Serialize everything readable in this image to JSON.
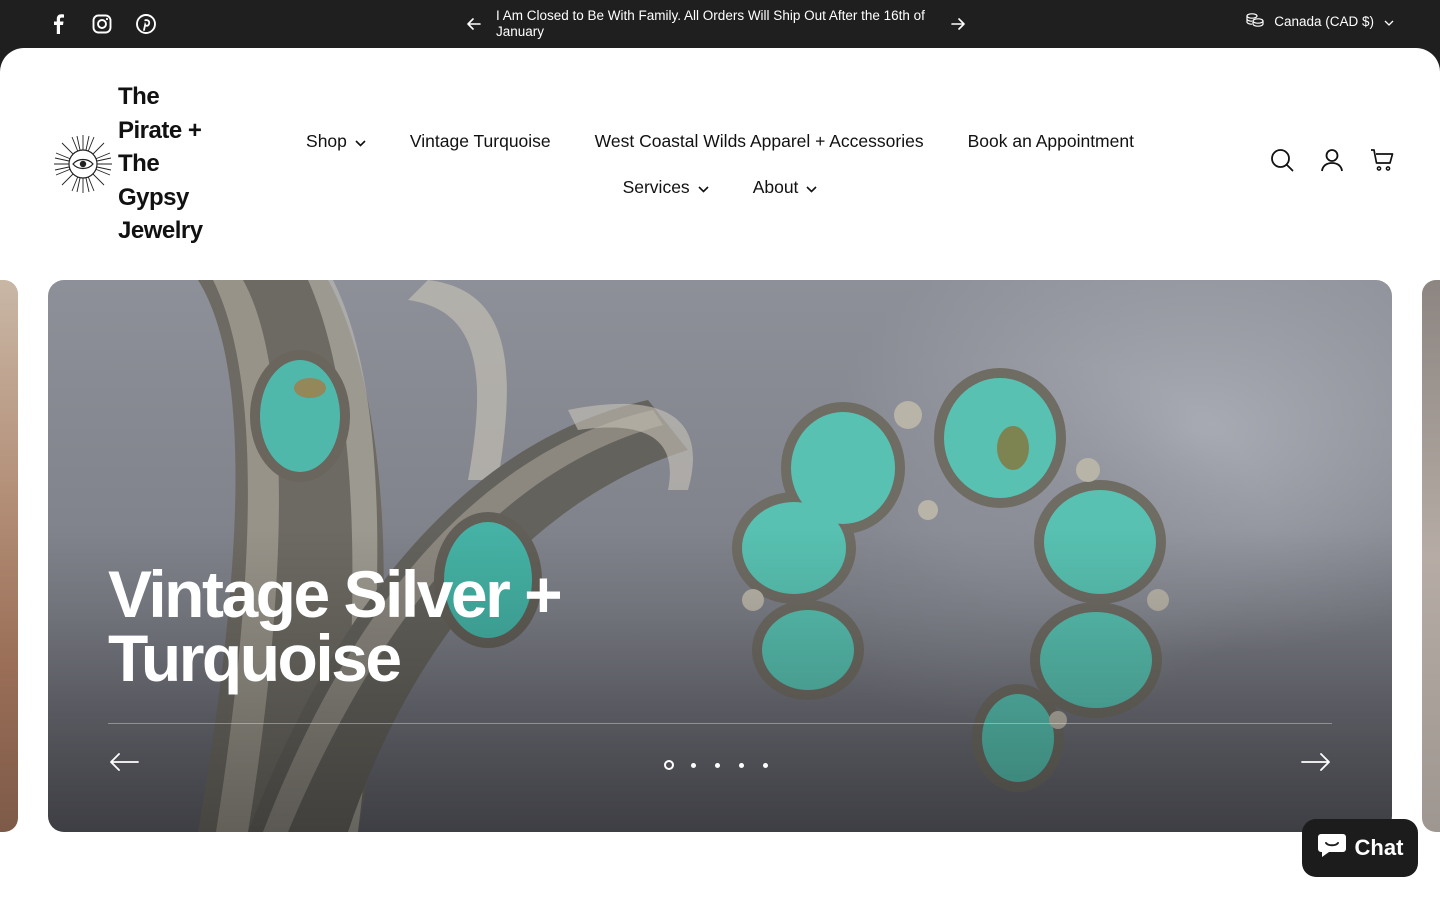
{
  "topbar": {
    "social": [
      "facebook-icon",
      "instagram-icon",
      "pinterest-icon"
    ],
    "announcement": "I Am Closed to Be With Family. All Orders Will Ship Out After the 16th of January",
    "currency": "Canada (CAD $)"
  },
  "header": {
    "brand": "The Pirate + The Gypsy Jewelry",
    "nav_row1": [
      {
        "label": "Shop",
        "dropdown": true
      },
      {
        "label": "Vintage Turquoise",
        "dropdown": false
      },
      {
        "label": "West Coastal Wilds Apparel + Accessories",
        "dropdown": false
      },
      {
        "label": "Book an Appointment",
        "dropdown": false
      }
    ],
    "nav_row2": [
      {
        "label": "Services",
        "dropdown": true
      },
      {
        "label": "About",
        "dropdown": true
      }
    ],
    "tools": [
      "search-icon",
      "account-icon",
      "cart-icon"
    ]
  },
  "hero": {
    "title": "Vintage Silver + Turquoise",
    "slide_count": 5,
    "active_slide": 1
  },
  "chat": {
    "label": "Chat"
  },
  "colors": {
    "topbar_bg": "#1f1f1f",
    "text": "#111111",
    "turquoise": "#56c2b2",
    "silver": "#a9a59c"
  }
}
